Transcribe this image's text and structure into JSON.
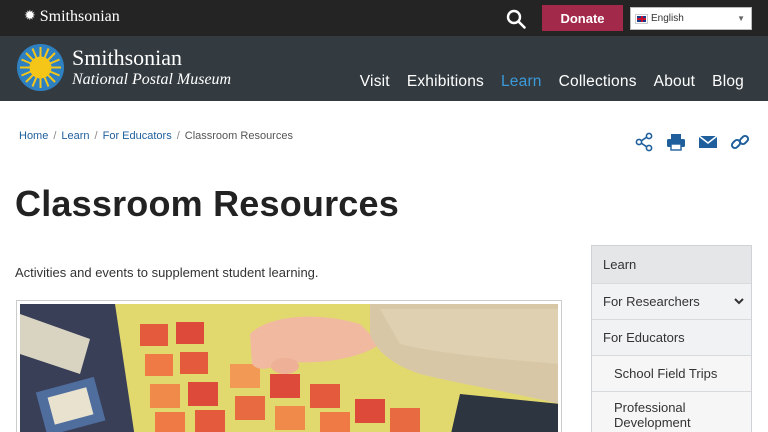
{
  "topbar": {
    "brand": "Smithsonian",
    "donate_label": "Donate",
    "language": "English"
  },
  "header": {
    "name_line1": "Smithsonian",
    "name_line2": "National Postal Museum",
    "nav": [
      "Visit",
      "Exhibitions",
      "Learn",
      "Collections",
      "About",
      "Blog"
    ],
    "active_nav": "Learn"
  },
  "breadcrumb": {
    "items": [
      "Home",
      "Learn",
      "For Educators"
    ],
    "current": "Classroom Resources"
  },
  "share_icons": [
    "share-icon",
    "print-icon",
    "email-icon",
    "link-icon"
  ],
  "page": {
    "title": "Classroom Resources",
    "intro": "Activities and events to supplement student learning."
  },
  "sidenav": {
    "items": [
      "Learn",
      "For Researchers",
      "For Educators",
      "School Field Trips",
      "Professional Development"
    ]
  },
  "colors": {
    "topbar": "#242424",
    "header": "#333b41",
    "donate": "#a3294a",
    "accent": "#3b9ad9",
    "link": "#1f5f9c"
  }
}
